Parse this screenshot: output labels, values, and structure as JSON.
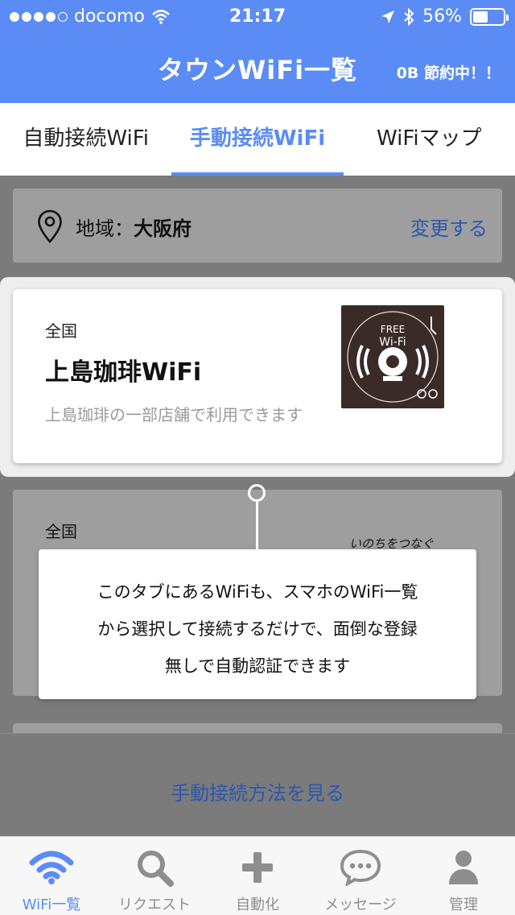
{
  "status_bar": {
    "carrier": "docomo",
    "time": "21:17",
    "battery": "56%",
    "battery_level": 0.56
  },
  "header": {
    "title": "タウンWiFi一覧",
    "saving": "0B 節約中！！"
  },
  "tabs": [
    {
      "label": "自動接続WiFi",
      "active": false
    },
    {
      "label": "手動接続WiFi",
      "active": true
    },
    {
      "label": "WiFiマップ",
      "active": false
    }
  ],
  "region": {
    "label": "地域：",
    "value": "大阪府",
    "change": "変更する"
  },
  "wifi_cards": [
    {
      "area": "全国",
      "name": "上島珈琲WiFi",
      "description": "上島珈琲の一部店舗で利用できます",
      "logo_text": "FREE Wi-Fi",
      "logo_color": "#3a2a28"
    },
    {
      "area": "全国",
      "tagline": "いのちをつなぐ"
    }
  ],
  "tooltip": {
    "lines": [
      "このタブにあるWiFiも、スマホのWiFi一覧",
      "から選択して接続するだけで、面倒な登録",
      "無しで自動認証できます"
    ]
  },
  "howto": "手動接続方法を見る",
  "tabbar": [
    {
      "label": "WiFi一覧",
      "icon": "wifi-icon",
      "active": true
    },
    {
      "label": "リクエスト",
      "icon": "search-icon",
      "active": false
    },
    {
      "label": "自動化",
      "icon": "plus-icon",
      "active": false
    },
    {
      "label": "メッセージ",
      "icon": "chat-bubble-icon",
      "active": false
    },
    {
      "label": "管理",
      "icon": "person-icon",
      "active": false
    }
  ],
  "colors": {
    "accent": "#5b8cf5",
    "link": "#2c56b0",
    "overlay": "#7b7b7b"
  }
}
